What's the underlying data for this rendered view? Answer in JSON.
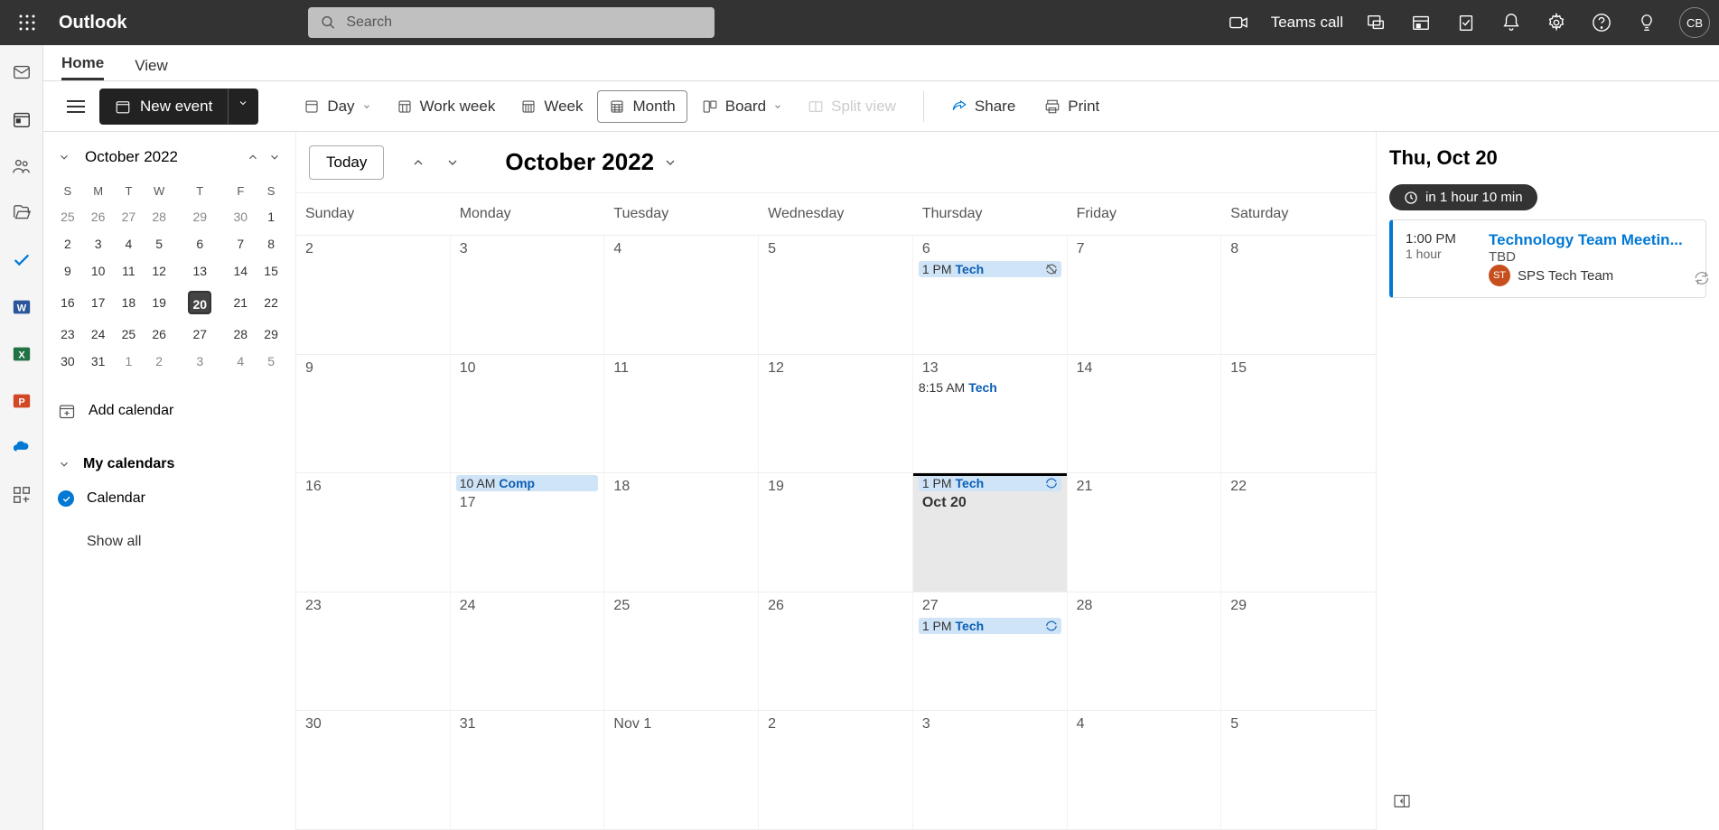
{
  "header": {
    "brand": "Outlook",
    "search_placeholder": "Search",
    "teams_call": "Teams call",
    "avatar_initials": "CB"
  },
  "tabs": {
    "home": "Home",
    "view": "View"
  },
  "toolbar": {
    "new_event": "New event",
    "day": "Day",
    "work_week": "Work week",
    "week": "Week",
    "month": "Month",
    "board": "Board",
    "split_view": "Split view",
    "share": "Share",
    "print": "Print"
  },
  "sidebar": {
    "month_title": "October 2022",
    "dow": [
      "S",
      "M",
      "T",
      "W",
      "T",
      "F",
      "S"
    ],
    "mini_weeks": [
      [
        {
          "n": "25",
          "o": true
        },
        {
          "n": "26",
          "o": true
        },
        {
          "n": "27",
          "o": true
        },
        {
          "n": "28",
          "o": true
        },
        {
          "n": "29",
          "o": true
        },
        {
          "n": "30",
          "o": true
        },
        {
          "n": "1"
        }
      ],
      [
        {
          "n": "2"
        },
        {
          "n": "3"
        },
        {
          "n": "4"
        },
        {
          "n": "5"
        },
        {
          "n": "6"
        },
        {
          "n": "7"
        },
        {
          "n": "8"
        }
      ],
      [
        {
          "n": "9"
        },
        {
          "n": "10"
        },
        {
          "n": "11"
        },
        {
          "n": "12"
        },
        {
          "n": "13"
        },
        {
          "n": "14"
        },
        {
          "n": "15"
        }
      ],
      [
        {
          "n": "16"
        },
        {
          "n": "17"
        },
        {
          "n": "18"
        },
        {
          "n": "19"
        },
        {
          "n": "20",
          "today": true
        },
        {
          "n": "21"
        },
        {
          "n": "22"
        }
      ],
      [
        {
          "n": "23"
        },
        {
          "n": "24"
        },
        {
          "n": "25"
        },
        {
          "n": "26"
        },
        {
          "n": "27"
        },
        {
          "n": "28"
        },
        {
          "n": "29"
        }
      ],
      [
        {
          "n": "30"
        },
        {
          "n": "31"
        },
        {
          "n": "1",
          "o": true
        },
        {
          "n": "2",
          "o": true
        },
        {
          "n": "3",
          "o": true
        },
        {
          "n": "4",
          "o": true
        },
        {
          "n": "5",
          "o": true
        }
      ]
    ],
    "add_calendar": "Add calendar",
    "my_calendars": "My calendars",
    "calendar_item": "Calendar",
    "show_all": "Show all"
  },
  "grid": {
    "today": "Today",
    "big_month": "October 2022",
    "dow": [
      "Sunday",
      "Monday",
      "Tuesday",
      "Wednesday",
      "Thursday",
      "Friday",
      "Saturday"
    ],
    "weeks": [
      [
        {
          "label": "2"
        },
        {
          "label": "3"
        },
        {
          "label": "4"
        },
        {
          "label": "5"
        },
        {
          "label": "6",
          "events": [
            {
              "chip": true,
              "time": "1 PM",
              "title": "Tech",
              "icon": "norepeat"
            }
          ]
        },
        {
          "label": "7"
        },
        {
          "label": "8"
        }
      ],
      [
        {
          "label": "9"
        },
        {
          "label": "10"
        },
        {
          "label": "11"
        },
        {
          "label": "12"
        },
        {
          "label": "13",
          "events": [
            {
              "chip": false,
              "time": "8:15 AM",
              "title": "Tech"
            }
          ]
        },
        {
          "label": "14"
        },
        {
          "label": "15"
        }
      ],
      [
        {
          "label": "16"
        },
        {
          "label": "17",
          "pre_events": [
            {
              "chip": true,
              "time": "10 AM",
              "title": "Comp"
            }
          ]
        },
        {
          "label": "18"
        },
        {
          "label": "19"
        },
        {
          "label": "Oct 20",
          "today": true,
          "pre_events": [
            {
              "chip": true,
              "time": "1 PM",
              "title": "Tech",
              "icon": "repeat"
            }
          ]
        },
        {
          "label": "21"
        },
        {
          "label": "22"
        }
      ],
      [
        {
          "label": "23"
        },
        {
          "label": "24"
        },
        {
          "label": "25"
        },
        {
          "label": "26"
        },
        {
          "label": "27",
          "events": [
            {
              "chip": true,
              "time": "1 PM",
              "title": "Tech",
              "icon": "repeat"
            }
          ]
        },
        {
          "label": "28"
        },
        {
          "label": "29"
        }
      ],
      [
        {
          "label": "30"
        },
        {
          "label": "31"
        },
        {
          "label": "Nov 1"
        },
        {
          "label": "2"
        },
        {
          "label": "3"
        },
        {
          "label": "4"
        },
        {
          "label": "5"
        }
      ]
    ]
  },
  "agenda": {
    "title": "Thu, Oct 20",
    "countdown": "in 1 hour 10 min",
    "event": {
      "time": "1:00 PM",
      "duration": "1 hour",
      "title": "Technology Team Meetin...",
      "location": "TBD",
      "organizer_initials": "ST",
      "organizer": "SPS Tech Team"
    }
  }
}
